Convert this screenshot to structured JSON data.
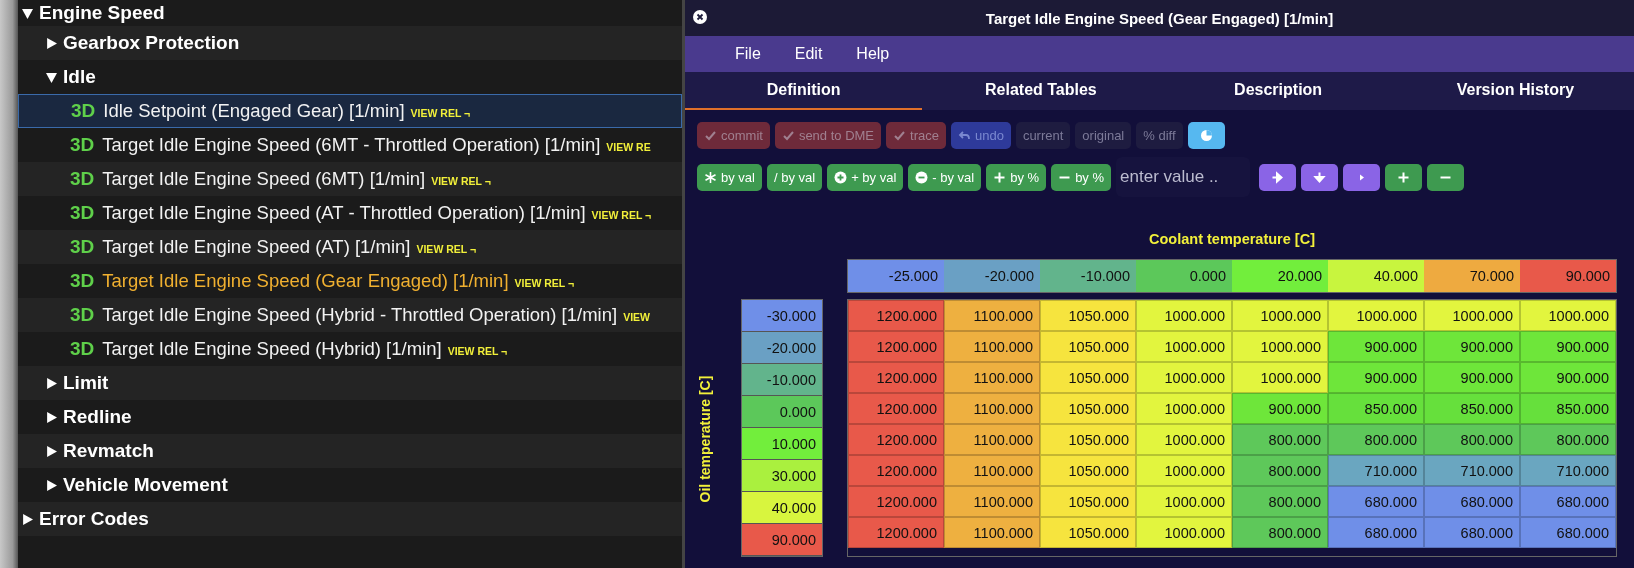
{
  "tree": [
    {
      "label": "Engine Speed",
      "expanded": true,
      "children": [
        {
          "label": "Gearbox Protection",
          "expanded": false
        },
        {
          "label": "Idle",
          "expanded": true,
          "children": [
            {
              "badge": "3D",
              "label": "Idle Setpoint (Engaged Gear) [1/min]",
              "link": "VIEW REL ¬",
              "selected": true,
              "active": false
            },
            {
              "badge": "3D",
              "label": "Target Idle Engine Speed (6MT - Throttled Operation) [1/min]",
              "link": "VIEW RE",
              "selected": false,
              "active": false
            },
            {
              "badge": "3D",
              "label": "Target Idle Engine Speed (6MT) [1/min]",
              "link": "VIEW REL ¬",
              "selected": false,
              "active": false
            },
            {
              "badge": "3D",
              "label": "Target Idle Engine Speed (AT - Throttled Operation) [1/min]",
              "link": "VIEW REL ¬",
              "selected": false,
              "active": false
            },
            {
              "badge": "3D",
              "label": "Target Idle Engine Speed (AT) [1/min]",
              "link": "VIEW REL ¬",
              "selected": false,
              "active": false
            },
            {
              "badge": "3D",
              "label": "Target Idle Engine Speed (Gear Engaged) [1/min]",
              "link": "VIEW REL ¬",
              "selected": false,
              "active": true
            },
            {
              "badge": "3D",
              "label": "Target Idle Engine Speed (Hybrid - Throttled Operation) [1/min]",
              "link": "VIEW",
              "selected": false,
              "active": false
            },
            {
              "badge": "3D",
              "label": "Target Idle Engine Speed (Hybrid) [1/min]",
              "link": "VIEW REL ¬",
              "selected": false,
              "active": false
            }
          ]
        },
        {
          "label": "Limit",
          "expanded": false
        },
        {
          "label": "Redline",
          "expanded": false
        },
        {
          "label": "Revmatch",
          "expanded": false
        },
        {
          "label": "Vehicle Movement",
          "expanded": false
        }
      ]
    },
    {
      "label": "Error Codes",
      "expanded": false
    }
  ],
  "window": {
    "title": "Target Idle Engine Speed (Gear Engaged) [1/min]",
    "menu": [
      "File",
      "Edit",
      "Help"
    ],
    "tabs": [
      {
        "label": "Definition",
        "selected": true
      },
      {
        "label": "Related Tables",
        "selected": false
      },
      {
        "label": "Description",
        "selected": false
      },
      {
        "label": "Version History",
        "selected": false
      }
    ],
    "toolbar_1": [
      {
        "label": "commit",
        "kind": "confirm"
      },
      {
        "label": "send to DME",
        "kind": "confirm"
      },
      {
        "label": "trace",
        "kind": "confirm"
      },
      {
        "label": "undo",
        "kind": "undo"
      },
      {
        "label": "current",
        "kind": "plain"
      },
      {
        "label": "original",
        "kind": "plain"
      },
      {
        "label": "% diff",
        "kind": "plain"
      },
      {
        "kind": "chart"
      }
    ],
    "toolbar_2": [
      {
        "label": "by val",
        "kind": "multiply"
      },
      {
        "label": "/ by val",
        "kind": "divide"
      },
      {
        "label": "+ by val",
        "kind": "add"
      },
      {
        "label": "- by val",
        "kind": "subtract"
      },
      {
        "label": "by %",
        "kind": "add-percent"
      },
      {
        "label": "by %",
        "kind": "subtract-percent"
      }
    ],
    "value_field": {
      "placeholder": "enter value .."
    },
    "toolbar_3": [
      {
        "kind": "fill-right"
      },
      {
        "kind": "fill-down"
      },
      {
        "kind": "step"
      },
      {
        "kind": "increase"
      },
      {
        "kind": "decrease"
      }
    ],
    "table": {
      "x_axis_title": "Coolant temperature [C]",
      "y_axis_title": "Oil temperature [C]",
      "columns": [
        {
          "value": "-25.000",
          "color": "#6f8fe8"
        },
        {
          "value": "-20.000",
          "color": "#6aa0c4"
        },
        {
          "value": "-10.000",
          "color": "#62b48c"
        },
        {
          "value": "0.000",
          "color": "#5cc85a"
        },
        {
          "value": "20.000",
          "color": "#72ee3c"
        },
        {
          "value": "40.000",
          "color": "#c8f53e"
        },
        {
          "value": "70.000",
          "color": "#eeaa40"
        },
        {
          "value": "90.000",
          "color": "#e8594a"
        }
      ],
      "rows": [
        {
          "label": {
            "value": "-30.000",
            "color": "#6f8fe8"
          },
          "cells": [
            {
              "value": "1200.000",
              "color": "#e8594a"
            },
            {
              "value": "1100.000",
              "color": "#eeb040"
            },
            {
              "value": "1050.000",
              "color": "#f6e43e"
            },
            {
              "value": "1000.000",
              "color": "#e2f53e"
            },
            {
              "value": "1000.000",
              "color": "#e2f53e"
            },
            {
              "value": "1000.000",
              "color": "#e2f53e"
            },
            {
              "value": "1000.000",
              "color": "#e2f53e"
            },
            {
              "value": "1000.000",
              "color": "#e2f53e"
            }
          ]
        },
        {
          "label": {
            "value": "-20.000",
            "color": "#6aa0c4"
          },
          "cells": [
            {
              "value": "1200.000",
              "color": "#e8594a"
            },
            {
              "value": "1100.000",
              "color": "#eeb040"
            },
            {
              "value": "1050.000",
              "color": "#f6e43e"
            },
            {
              "value": "1000.000",
              "color": "#e2f53e"
            },
            {
              "value": "1000.000",
              "color": "#e2f53e"
            },
            {
              "value": "900.000",
              "color": "#6ee63a"
            },
            {
              "value": "900.000",
              "color": "#6ee63a"
            },
            {
              "value": "900.000",
              "color": "#6ee63a"
            }
          ]
        },
        {
          "label": {
            "value": "-10.000",
            "color": "#62b48c"
          },
          "cells": [
            {
              "value": "1200.000",
              "color": "#e8594a"
            },
            {
              "value": "1100.000",
              "color": "#eeb040"
            },
            {
              "value": "1050.000",
              "color": "#f6e43e"
            },
            {
              "value": "1000.000",
              "color": "#e2f53e"
            },
            {
              "value": "1000.000",
              "color": "#e2f53e"
            },
            {
              "value": "900.000",
              "color": "#6ee63a"
            },
            {
              "value": "900.000",
              "color": "#6ee63a"
            },
            {
              "value": "900.000",
              "color": "#6ee63a"
            }
          ]
        },
        {
          "label": {
            "value": "0.000",
            "color": "#5cc85a"
          },
          "cells": [
            {
              "value": "1200.000",
              "color": "#e8594a"
            },
            {
              "value": "1100.000",
              "color": "#eeb040"
            },
            {
              "value": "1050.000",
              "color": "#f6e43e"
            },
            {
              "value": "1000.000",
              "color": "#e2f53e"
            },
            {
              "value": "900.000",
              "color": "#6ee63a"
            },
            {
              "value": "850.000",
              "color": "#66e03c"
            },
            {
              "value": "850.000",
              "color": "#66e03c"
            },
            {
              "value": "850.000",
              "color": "#66e03c"
            }
          ]
        },
        {
          "label": {
            "value": "10.000",
            "color": "#72ee3c"
          },
          "cells": [
            {
              "value": "1200.000",
              "color": "#e8594a"
            },
            {
              "value": "1100.000",
              "color": "#eeb040"
            },
            {
              "value": "1050.000",
              "color": "#f6e43e"
            },
            {
              "value": "1000.000",
              "color": "#e2f53e"
            },
            {
              "value": "800.000",
              "color": "#5ec85a"
            },
            {
              "value": "800.000",
              "color": "#5ec85a"
            },
            {
              "value": "800.000",
              "color": "#5ec85a"
            },
            {
              "value": "800.000",
              "color": "#5ec85a"
            }
          ]
        },
        {
          "label": {
            "value": "30.000",
            "color": "#aaf03e"
          },
          "cells": [
            {
              "value": "1200.000",
              "color": "#e8594a"
            },
            {
              "value": "1100.000",
              "color": "#eeb040"
            },
            {
              "value": "1050.000",
              "color": "#f6e43e"
            },
            {
              "value": "1000.000",
              "color": "#e2f53e"
            },
            {
              "value": "800.000",
              "color": "#5ec85a"
            },
            {
              "value": "710.000",
              "color": "#6aa6c0"
            },
            {
              "value": "710.000",
              "color": "#6aa6c0"
            },
            {
              "value": "710.000",
              "color": "#6aa6c0"
            }
          ]
        },
        {
          "label": {
            "value": "40.000",
            "color": "#d8f53e"
          },
          "cells": [
            {
              "value": "1200.000",
              "color": "#e8594a"
            },
            {
              "value": "1100.000",
              "color": "#eeb040"
            },
            {
              "value": "1050.000",
              "color": "#f6e43e"
            },
            {
              "value": "1000.000",
              "color": "#e2f53e"
            },
            {
              "value": "800.000",
              "color": "#5ec85a"
            },
            {
              "value": "680.000",
              "color": "#6f8fe8"
            },
            {
              "value": "680.000",
              "color": "#6f8fe8"
            },
            {
              "value": "680.000",
              "color": "#6f8fe8"
            }
          ]
        },
        {
          "label": {
            "value": "90.000",
            "color": "#e8594a"
          },
          "cells": [
            {
              "value": "1200.000",
              "color": "#e8594a"
            },
            {
              "value": "1100.000",
              "color": "#eeb040"
            },
            {
              "value": "1050.000",
              "color": "#f6e43e"
            },
            {
              "value": "1000.000",
              "color": "#e2f53e"
            },
            {
              "value": "800.000",
              "color": "#5ec85a"
            },
            {
              "value": "680.000",
              "color": "#6f8fe8"
            },
            {
              "value": "680.000",
              "color": "#6f8fe8"
            },
            {
              "value": "680.000",
              "color": "#6f8fe8"
            }
          ]
        }
      ]
    }
  }
}
